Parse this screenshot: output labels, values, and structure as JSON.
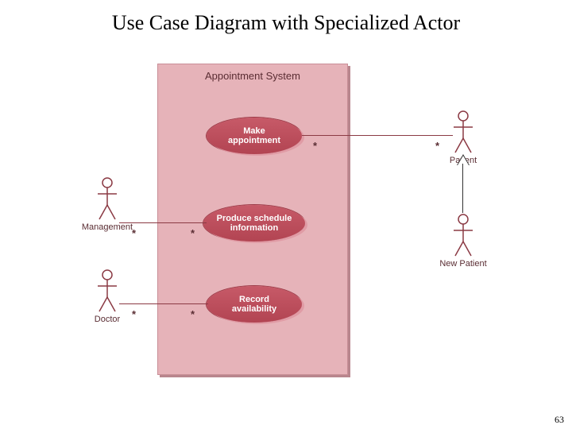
{
  "title": "Use Case Diagram with Specialized Actor",
  "page_number": "63",
  "system": {
    "name": "Appointment System"
  },
  "use_cases": {
    "make": "Make\nappointment",
    "sched": "Produce schedule\ninformation",
    "avail": "Record\navailability"
  },
  "actors": {
    "management": "Management",
    "doctor": "Doctor",
    "patient": "Patient",
    "newpatient": "New Patient"
  },
  "mult": "*",
  "associations": [
    {
      "from": "management",
      "to": "sched",
      "left_mult": "*",
      "right_mult": "*"
    },
    {
      "from": "doctor",
      "to": "avail",
      "left_mult": "*",
      "right_mult": "*"
    },
    {
      "from": "patient",
      "to": "make",
      "left_mult": "*",
      "right_mult": "*"
    }
  ],
  "generalization": {
    "child": "newpatient",
    "parent": "patient"
  }
}
